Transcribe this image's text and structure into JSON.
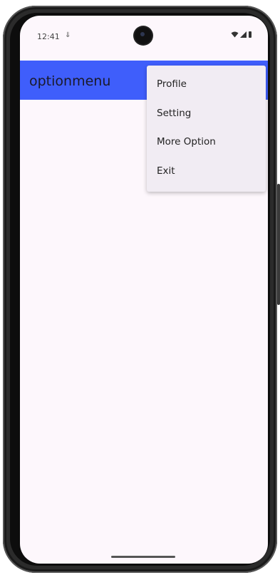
{
  "status_bar": {
    "time": "12:41",
    "notification_icon": "usb-icon"
  },
  "app_bar": {
    "title": "optionmenu",
    "color": "#3f5efb"
  },
  "menu": {
    "items": [
      {
        "label": "Profile"
      },
      {
        "label": "Setting"
      },
      {
        "label": "More Option"
      },
      {
        "label": "Exit"
      }
    ]
  },
  "colors": {
    "background": "#fdf7fc",
    "menu_background": "#f1ecf3"
  }
}
